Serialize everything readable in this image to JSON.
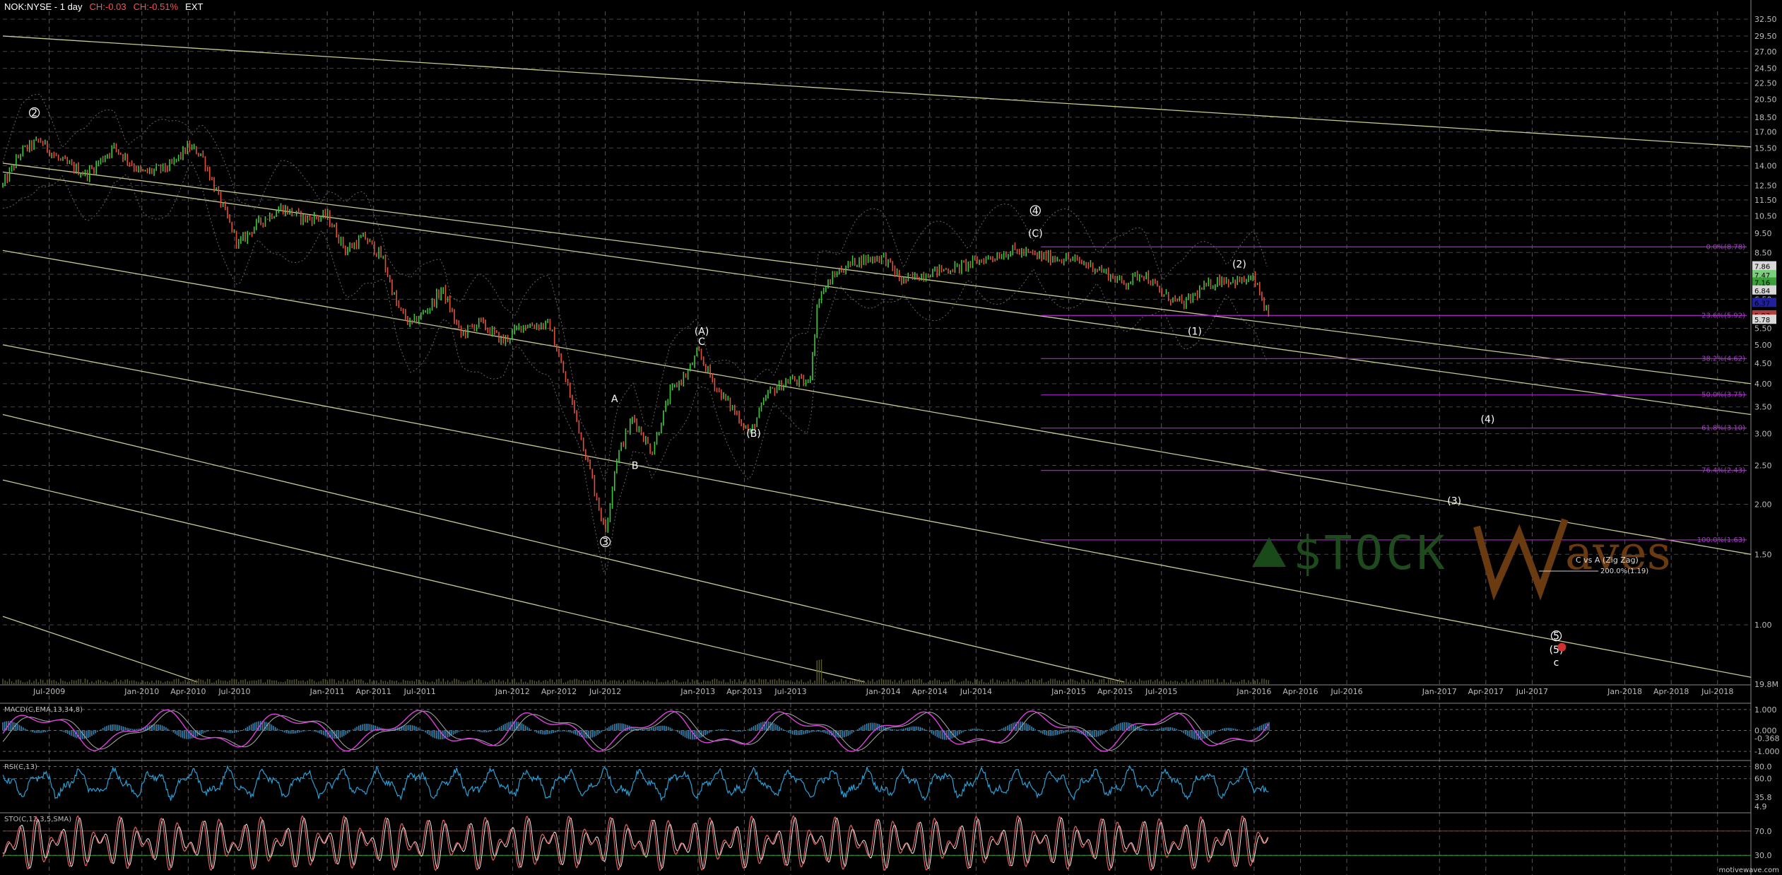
{
  "header": {
    "symbol": "NOK:NYSE - 1 day",
    "change": "CH:-0.03",
    "change_pct": "CH:-0.51%",
    "session": "EXT",
    "colors": {
      "symbol": "#ffffff",
      "change": "#ff5050",
      "session": "#ffffff"
    }
  },
  "watermark": {
    "left": "$TOCK",
    "right": "aves",
    "note": "C vs A (Zig Zag)",
    "note_value": "200.0%(1.19)"
  },
  "footer": {
    "brand": "motivewave.com"
  },
  "volume_label": "19.8M",
  "chart_data": [
    {
      "type": "line",
      "name": "price",
      "scale": "log",
      "ylim": [
        0.72,
        34
      ],
      "y_ticks": [
        32.5,
        29.5,
        27.0,
        24.5,
        22.5,
        20.5,
        18.5,
        17.0,
        15.5,
        14.0,
        12.5,
        11.5,
        10.5,
        9.5,
        8.5,
        7.5,
        6.5,
        5.5,
        5.0,
        4.5,
        4.0,
        3.5,
        3.0,
        2.5,
        2.0,
        1.5,
        1.0
      ],
      "y_tick_labels": [
        "32.50",
        "29.50",
        "27.00",
        "24.50",
        "22.50",
        "20.50",
        "18.50",
        "17.00",
        "15.50",
        "14.00",
        "12.50",
        "11.50",
        "10.50",
        "9.50",
        "8.50",
        "7.50",
        "6.50",
        "5.50",
        "5.00",
        "4.50",
        "4.00",
        "3.50",
        "3.00",
        "2.50",
        "2.00",
        "1.50",
        "1.00"
      ],
      "x_ticks": [
        "Jul-2009",
        "Jan-2010",
        "Apr-2010",
        "Jul-2010",
        "Jan-2011",
        "Apr-2011",
        "Jul-2011",
        "Jan-2012",
        "Apr-2012",
        "Jul-2012",
        "Jan-2013",
        "Apr-2013",
        "Jul-2013",
        "Jan-2014",
        "Apr-2014",
        "Jul-2014",
        "Jan-2015",
        "Apr-2015",
        "Jul-2015",
        "Jan-2016",
        "Apr-2016",
        "Jul-2016",
        "Jan-2017",
        "Apr-2017",
        "Jul-2017",
        "Jan-2018",
        "Apr-2018",
        "Jul-2018"
      ],
      "x_tick_t": [
        2009.5,
        2010.0,
        2010.25,
        2010.5,
        2011.0,
        2011.25,
        2011.5,
        2012.0,
        2012.25,
        2012.5,
        2013.0,
        2013.25,
        2013.5,
        2014.0,
        2014.25,
        2014.5,
        2015.0,
        2015.25,
        2015.5,
        2016.0,
        2016.25,
        2016.5,
        2017.0,
        2017.25,
        2017.5,
        2018.0,
        2018.25,
        2018.5
      ],
      "xlim": [
        2009.25,
        2018.68
      ],
      "price_path": [
        [
          2009.25,
          12.5
        ],
        [
          2009.35,
          15.2
        ],
        [
          2009.45,
          16.2
        ],
        [
          2009.55,
          14.5
        ],
        [
          2009.7,
          13.3
        ],
        [
          2009.85,
          15.6
        ],
        [
          2010.0,
          13.4
        ],
        [
          2010.15,
          13.9
        ],
        [
          2010.25,
          15.6
        ],
        [
          2010.32,
          15.0
        ],
        [
          2010.42,
          11.5
        ],
        [
          2010.52,
          8.9
        ],
        [
          2010.62,
          10.0
        ],
        [
          2010.75,
          11.0
        ],
        [
          2010.88,
          10.3
        ],
        [
          2011.0,
          10.5
        ],
        [
          2011.1,
          8.6
        ],
        [
          2011.2,
          9.3
        ],
        [
          2011.3,
          8.2
        ],
        [
          2011.38,
          6.2
        ],
        [
          2011.45,
          5.6
        ],
        [
          2011.55,
          6.2
        ],
        [
          2011.62,
          6.9
        ],
        [
          2011.72,
          5.3
        ],
        [
          2011.82,
          5.7
        ],
        [
          2011.95,
          5.1
        ],
        [
          2012.05,
          5.6
        ],
        [
          2012.2,
          5.6
        ],
        [
          2012.32,
          3.6
        ],
        [
          2012.42,
          2.4
        ],
        [
          2012.5,
          1.7
        ],
        [
          2012.56,
          2.6
        ],
        [
          2012.65,
          3.3
        ],
        [
          2012.75,
          2.7
        ],
        [
          2012.85,
          3.8
        ],
        [
          2012.95,
          4.3
        ],
        [
          2013.0,
          4.8
        ],
        [
          2013.1,
          3.9
        ],
        [
          2013.2,
          3.4
        ],
        [
          2013.28,
          3.0
        ],
        [
          2013.38,
          3.8
        ],
        [
          2013.5,
          4.1
        ],
        [
          2013.6,
          4.0
        ],
        [
          2013.65,
          6.6
        ],
        [
          2013.75,
          7.6
        ],
        [
          2013.85,
          8.1
        ],
        [
          2014.0,
          8.3
        ],
        [
          2014.1,
          7.2
        ],
        [
          2014.25,
          7.6
        ],
        [
          2014.4,
          7.8
        ],
        [
          2014.55,
          8.2
        ],
        [
          2014.7,
          8.6
        ],
        [
          2014.85,
          8.3
        ],
        [
          2015.0,
          8.2
        ],
        [
          2015.15,
          7.8
        ],
        [
          2015.3,
          7.1
        ],
        [
          2015.4,
          7.6
        ],
        [
          2015.5,
          6.7
        ],
        [
          2015.62,
          6.3
        ],
        [
          2015.72,
          6.9
        ],
        [
          2015.82,
          7.3
        ],
        [
          2015.92,
          7.2
        ],
        [
          2016.0,
          7.3
        ],
        [
          2016.08,
          5.8
        ]
      ],
      "wave_labels": [
        {
          "t": 2009.42,
          "v": 18.6,
          "text": "2",
          "circled": true
        },
        {
          "t": 2012.5,
          "v": 1.58,
          "text": "3",
          "circled": true
        },
        {
          "t": 2012.55,
          "v": 3.6,
          "text": "A",
          "circled": false
        },
        {
          "t": 2012.66,
          "v": 2.45,
          "text": "B",
          "circled": false
        },
        {
          "t": 2013.02,
          "v": 5.3,
          "text": "(A)",
          "circled": false
        },
        {
          "t": 2013.02,
          "v": 5.0,
          "text": "C",
          "circled": false
        },
        {
          "t": 2013.3,
          "v": 2.95,
          "text": "(B)",
          "circled": false
        },
        {
          "t": 2014.82,
          "v": 10.6,
          "text": "4",
          "circled": true
        },
        {
          "t": 2014.82,
          "v": 9.3,
          "text": "(C)",
          "circled": false
        },
        {
          "t": 2015.68,
          "v": 5.3,
          "text": "(1)",
          "circled": false
        },
        {
          "t": 2015.92,
          "v": 7.8,
          "text": "(2)",
          "circled": false
        },
        {
          "t": 2017.08,
          "v": 2.0,
          "text": "(3)",
          "circled": false
        },
        {
          "t": 2017.26,
          "v": 3.2,
          "text": "(4)",
          "circled": false
        },
        {
          "t": 2017.63,
          "v": 0.92,
          "text": "5",
          "circled": true
        },
        {
          "t": 2017.63,
          "v": 0.85,
          "text": "(5)",
          "circled": false
        },
        {
          "t": 2017.63,
          "v": 0.79,
          "text": "c",
          "circled": false
        }
      ],
      "fib_levels": [
        {
          "v": 8.78,
          "label": "0.0%(8.78)"
        },
        {
          "v": 5.92,
          "label": "23.6%(5.92)"
        },
        {
          "v": 4.62,
          "label": "38.2%(4.62)"
        },
        {
          "v": 3.75,
          "label": "50.0%(3.75)"
        },
        {
          "v": 3.1,
          "label": "61.8%(3.10)"
        },
        {
          "v": 2.43,
          "label": "76.4%(2.43)"
        },
        {
          "v": 1.63,
          "label": "100.0%(1.63)"
        }
      ],
      "right_price_labels": [
        {
          "v": 7.86,
          "text": "7.86",
          "color": "#d8d8d8"
        },
        {
          "v": 7.47,
          "text": "7.47",
          "color": "#7ad07a"
        },
        {
          "v": 7.16,
          "text": "7.16",
          "color": "#3aa03a"
        },
        {
          "v": 6.84,
          "text": "6.84",
          "color": "#d8d8d8"
        },
        {
          "v": 6.37,
          "text": "6.37",
          "color": "#2020a0"
        },
        {
          "v": 5.93,
          "text": "5.93",
          "color": "#b04040"
        },
        {
          "v": 5.78,
          "text": "5.78",
          "color": "#d8d8d8"
        }
      ],
      "trend_lines": [
        {
          "t1": 2009.25,
          "v1": 29.5,
          "t2": 2018.68,
          "v2": 15.6
        },
        {
          "t1": 2009.25,
          "v1": 14.2,
          "t2": 2018.68,
          "v2": 4.0
        },
        {
          "t1": 2009.25,
          "v1": 13.5,
          "t2": 2018.68,
          "v2": 3.35
        },
        {
          "t1": 2009.25,
          "v1": 8.6,
          "t2": 2018.68,
          "v2": 1.5
        },
        {
          "t1": 2009.25,
          "v1": 5.0,
          "t2": 2018.68,
          "v2": 0.74
        },
        {
          "t1": 2009.25,
          "v1": 3.35,
          "t2": 2015.3,
          "v2": 0.72
        },
        {
          "t1": 2009.25,
          "v1": 2.3,
          "t2": 2013.9,
          "v2": 0.72
        },
        {
          "t1": 2009.25,
          "v1": 1.05,
          "t2": 2010.3,
          "v2": 0.72
        }
      ]
    },
    {
      "type": "line",
      "name": "MACD(C,EMA,13,34,8)",
      "label": "MACD(C,EMA,13,34,8)",
      "ylim": [
        -1.3,
        1.3
      ],
      "y_ticks": [
        1.0,
        0.0,
        -1.0
      ],
      "y_tick_labels": [
        "1.000",
        "0.000",
        "-1.000"
      ],
      "last_value": "-0.368"
    },
    {
      "type": "line",
      "name": "RSI(C,13)",
      "label": "RSI(C,13)",
      "ylim": [
        15,
        90
      ],
      "y_ticks": [
        80,
        60
      ],
      "y_tick_labels": [
        "80.0",
        "60.0"
      ],
      "last_values": [
        "35.8",
        "4.9"
      ]
    },
    {
      "type": "line",
      "name": "STO(C,12,3,5,SMA)",
      "label": "STO(C,12,3,5,SMA)",
      "ylim": [
        0,
        100
      ],
      "y_ticks": [
        70,
        30
      ],
      "y_tick_labels": [
        "70.0",
        "30.0"
      ]
    }
  ]
}
